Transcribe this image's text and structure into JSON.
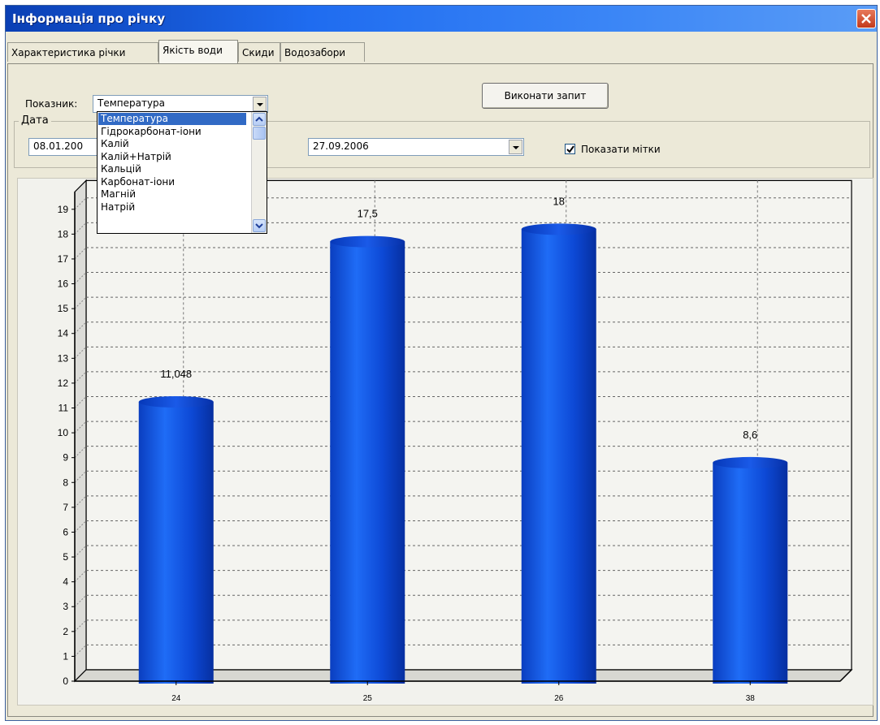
{
  "window": {
    "title": "Інформація про річку"
  },
  "tabs": [
    {
      "label": "Характеристика річки",
      "active": false
    },
    {
      "label": "Якість води",
      "active": true
    },
    {
      "label": "Скиди",
      "active": false
    },
    {
      "label": "Водозабори",
      "active": false
    }
  ],
  "form": {
    "indicator_label": "Показник:",
    "indicator_value": "Температура",
    "execute_button": "Виконати запит",
    "date_group_title": "Дата",
    "date_from": "08.01.200",
    "date_to": "27.09.2006",
    "show_labels_text": "Показати мітки",
    "show_labels_checked": true
  },
  "dropdown": {
    "options": [
      "Температура",
      "Гідрокарбонат-іони",
      "Калій",
      "Калій+Натрій",
      "Кальцій",
      "Карбонат-іони",
      "Магній",
      "Натрій"
    ],
    "selected_index": 0
  },
  "chart_data": {
    "type": "bar",
    "categories": [
      "24",
      "25",
      "26",
      "38"
    ],
    "values": [
      11.048,
      17.5,
      18,
      8.6
    ],
    "data_labels": [
      "11,048",
      "17,5",
      "18",
      "8,6"
    ],
    "y_ticks": [
      "0",
      "1",
      "2",
      "3",
      "4",
      "5",
      "6",
      "7",
      "8",
      "9",
      "10",
      "11",
      "12",
      "13",
      "14",
      "15",
      "16",
      "17",
      "18",
      "19"
    ],
    "ylim": [
      0,
      19.7
    ],
    "grid": true,
    "bar_color": "#1048d8",
    "title": "",
    "xlabel": "",
    "ylabel": ""
  }
}
